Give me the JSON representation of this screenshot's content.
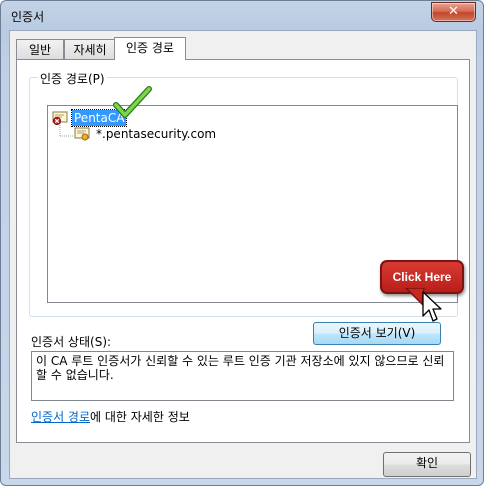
{
  "window": {
    "title": "인증서",
    "close_glyph": "✕"
  },
  "tabs": [
    {
      "label": "일반"
    },
    {
      "label": "자세히"
    },
    {
      "label": "인증 경로",
      "active": true
    }
  ],
  "group": {
    "label": "인증 경로(P)"
  },
  "tree": {
    "root": {
      "label": "PentaCA",
      "icon": "cert-error-icon",
      "selected": true
    },
    "child": {
      "label": "*.pentasecurity.com",
      "icon": "cert-warning-icon"
    }
  },
  "buttons": {
    "view_cert": "인증서 보기(V)",
    "ok": "확인"
  },
  "status": {
    "label": "인증서 상태(S):",
    "text": "이 CA 루트 인증서가 신뢰할 수 있는 루트 인증 기관 저장소에 있지 않으므로 신뢰할 수 없습니다."
  },
  "info": {
    "link_text": "인증서 경로",
    "suffix": "에 대한 자세한 정보"
  },
  "annotation": {
    "callout_text": "Click Here",
    "checkmark_icon": "green-checkmark-icon",
    "cursor_icon": "mouse-pointer-icon",
    "callout_color": "#c8281f",
    "check_color": "#58b030"
  },
  "colors": {
    "selection": "#3399ff",
    "link": "#0066cc"
  }
}
